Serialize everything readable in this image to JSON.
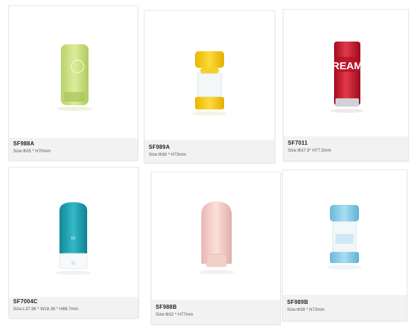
{
  "products": [
    {
      "code": "SF988A",
      "size": "Size:Φ35 * H70mm"
    },
    {
      "code": "SF989A",
      "size": "Size:Φ38 * H73mm"
    },
    {
      "code": "SF7011",
      "size": "Size:Φ37.5* H77.5mm"
    },
    {
      "code": "SF7004C",
      "size": "Size:L37.96 * W18.36 * H88.7mm"
    },
    {
      "code": "SF988B",
      "size": "Size:Φ32 * H77mm"
    },
    {
      "code": "SF989B",
      "size": "Size:Φ38 * H73mm"
    }
  ],
  "colors": {
    "caption_bg": "#f2f2f2",
    "green": "#c9df7a",
    "yellow": "#f2c80f",
    "red": "#c8102e",
    "teal": "#1fa3b3",
    "pink": "#f1c6c1",
    "light_blue": "#7fc8e6"
  },
  "icons": [
    "green-stick-image",
    "yellow-stick-image",
    "red-stick-image",
    "teal-stick-image",
    "pink-stick-image",
    "blue-stick-image"
  ]
}
